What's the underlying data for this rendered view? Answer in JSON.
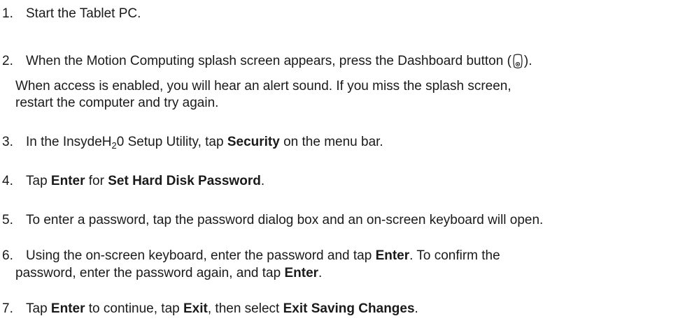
{
  "steps": [
    {
      "number": "1.",
      "text": "Start the Tablet PC."
    },
    {
      "number": "2.",
      "text_before_icon": "When the Motion Computing splash screen appears, press the Dashboard button (",
      "text_after_icon": ").",
      "icon": "dashboard-button-icon",
      "note_line1": "When access is enabled, you will hear an alert sound. If you miss the splash screen,",
      "note_line2": "restart the computer and try again."
    },
    {
      "number": "3.",
      "text_a": "In the InsydeH",
      "subscript": "2",
      "text_b": "0 Setup Utility, tap ",
      "bold": "Security",
      "text_c": " on the menu bar."
    },
    {
      "number": "4.",
      "text_a": "Tap ",
      "bold_a": "Enter",
      "text_b": " for ",
      "bold_b": "Set Hard Disk Password",
      "text_c": "."
    },
    {
      "number": "5.",
      "text": "To enter a password, tap the password dialog box and an on-screen keyboard will open."
    },
    {
      "number": "6.",
      "text_a": "Using the on-screen keyboard, enter the password and tap ",
      "bold_a": "Enter",
      "text_b": ". To confirm the",
      "line2_a": "password, enter the password again, and tap ",
      "bold_b": "Enter",
      "line2_b": "."
    },
    {
      "number": "7.",
      "text_a": "Tap ",
      "bold_a": "Enter",
      "text_b": " to continue, tap ",
      "bold_b": "Exit",
      "text_c": ", then select ",
      "bold_c": "Exit Saving Changes",
      "text_d": "."
    }
  ]
}
